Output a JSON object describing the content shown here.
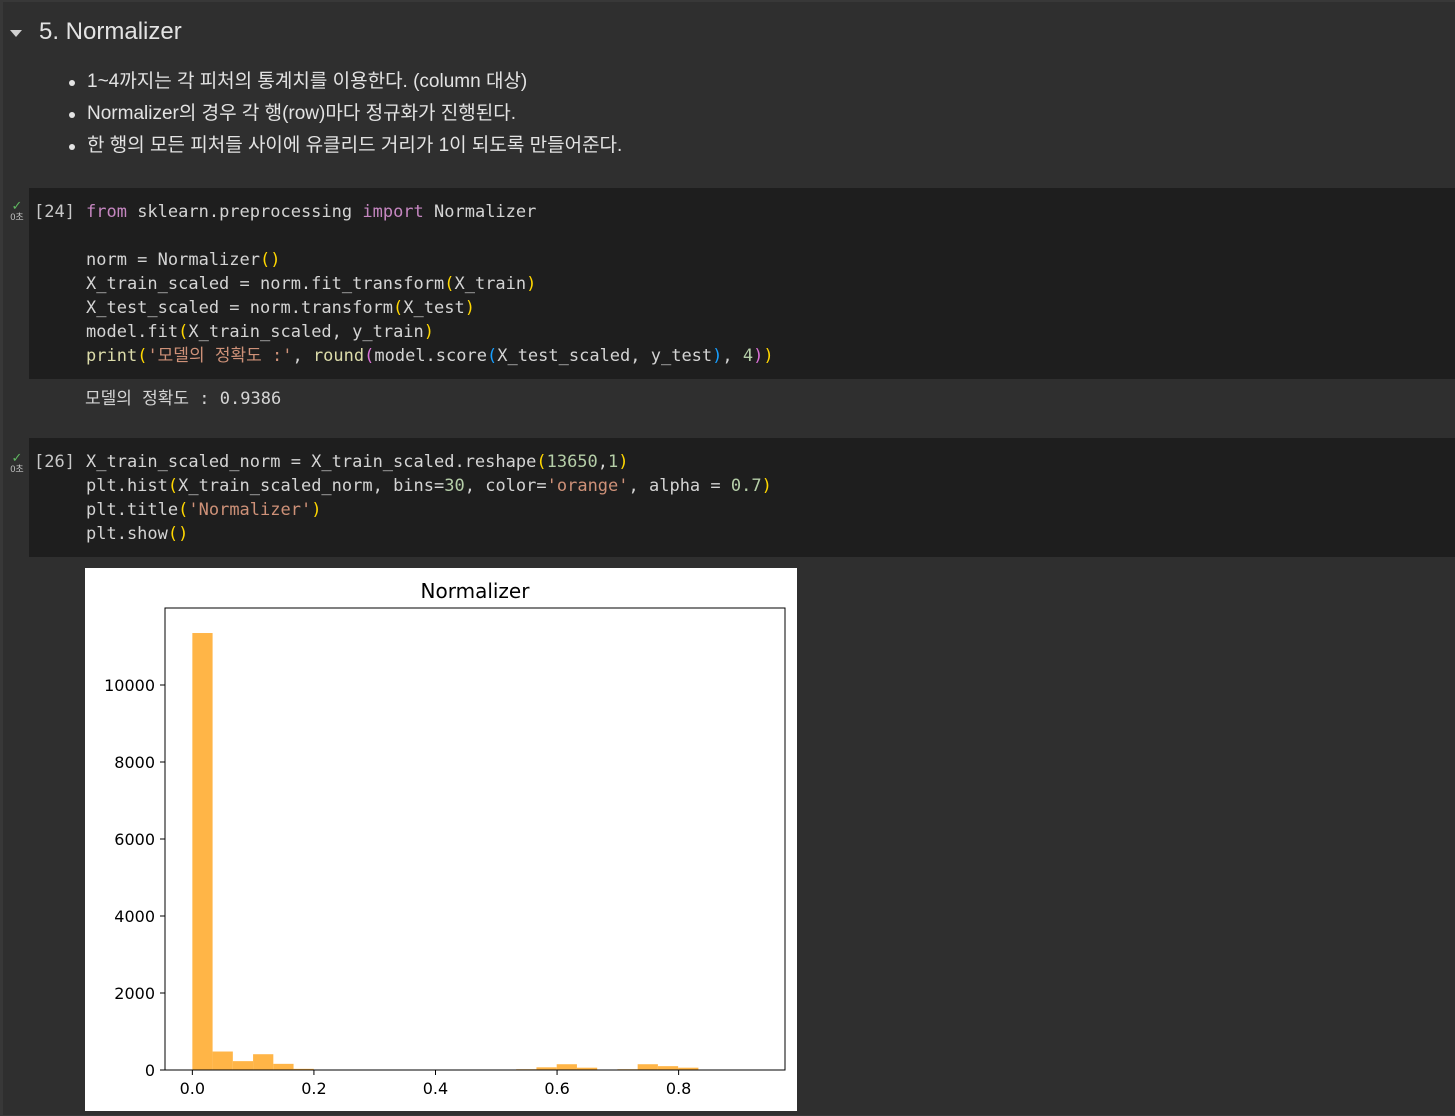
{
  "section": {
    "title": "5. Normalizer",
    "bullets": [
      "1~4까지는 각 피처의 통계치를 이용한다. (column 대상)",
      "Normalizer의 경우 각 행(row)마다 정규화가 진행된다.",
      "한 행의 모든 피처들 사이에 유클리드 거리가 1이 되도록 만들어준다."
    ]
  },
  "cells": [
    {
      "exec_count": "[24]",
      "exec_time": "0초",
      "output": "모델의 정확도 : 0.9386"
    },
    {
      "exec_count": "[26]",
      "exec_time": "0초"
    }
  ],
  "colors": {
    "background": "#2f2f2f",
    "code_background": "#1e1e1e",
    "bar": "#ffb547",
    "check": "#5fb760"
  },
  "chart_data": {
    "type": "bar",
    "title": "Normalizer",
    "xlabel": "",
    "ylabel": "",
    "bin_start": 0.0,
    "bin_width": 0.0333,
    "values": [
      11350,
      480,
      230,
      410,
      160,
      30,
      5,
      0,
      0,
      0,
      0,
      0,
      0,
      0,
      0,
      0,
      20,
      70,
      150,
      60,
      10,
      20,
      150,
      100,
      60,
      10
    ],
    "xlim": [
      -0.045,
      0.975
    ],
    "ylim": [
      0,
      12000
    ],
    "xticks": [
      0.0,
      0.2,
      0.4,
      0.6,
      0.8
    ],
    "xtick_labels": [
      "0.0",
      "0.2",
      "0.4",
      "0.6",
      "0.8"
    ],
    "yticks": [
      0,
      2000,
      4000,
      6000,
      8000,
      10000
    ],
    "ytick_labels": [
      "0",
      "2000",
      "4000",
      "6000",
      "8000",
      "10000"
    ],
    "grid": false,
    "alpha": 0.7
  }
}
